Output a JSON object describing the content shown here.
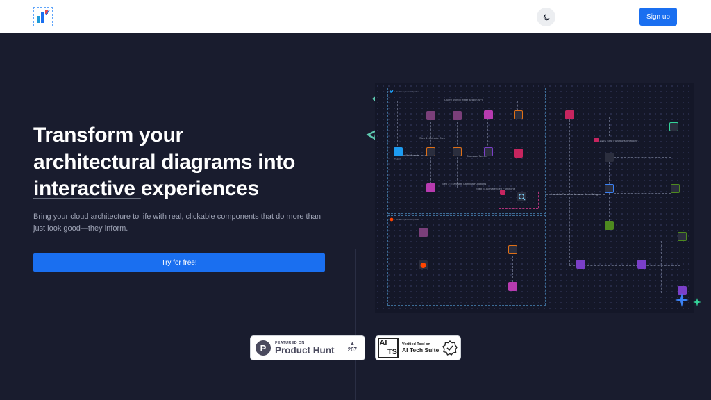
{
  "header": {
    "logo_icon": "diagram-logo-icon",
    "theme_icon": "moon-icon",
    "signup_label": "Sign up"
  },
  "hero": {
    "title_line1": "Transform your",
    "title_line2": "architectural diagrams into",
    "title_line3a": "interactive ",
    "title_line3b": "experiences",
    "subtitle": "Bring your cloud architecture to life with real, clickable components that do more than just look good—they inform.",
    "cta_label": "Try for free!"
  },
  "badges": {
    "producthunt": {
      "logo_letter": "P",
      "small": "FEATURED ON",
      "big": "Product Hunt",
      "votes": "207",
      "arrow": "▲"
    },
    "aits": {
      "logo": [
        "AI",
        "TS"
      ],
      "small": "Verified Tool on",
      "big": "AI Tech Suite"
    }
  },
  "colors": {
    "accent": "#1a6ff0",
    "hero_bg": "#191c2e",
    "diagram_bg": "#141728",
    "aws_pink": "#c7255f",
    "aws_purple": "#7a3fc8",
    "aws_orange": "#e07017",
    "aws_green": "#4e8a1f",
    "sparkle_blue": "#3b82f6",
    "sparkle_teal": "#34d399"
  }
}
